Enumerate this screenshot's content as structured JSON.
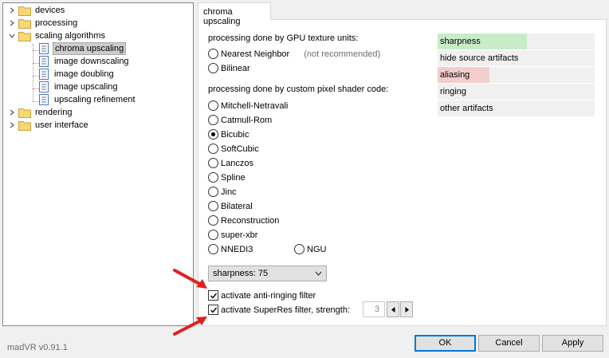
{
  "tree": {
    "items": [
      {
        "label": "devices"
      },
      {
        "label": "processing"
      },
      {
        "label": "scaling algorithms"
      },
      {
        "label": "chroma upscaling"
      },
      {
        "label": "image downscaling"
      },
      {
        "label": "image doubling"
      },
      {
        "label": "image upscaling"
      },
      {
        "label": "upscaling refinement"
      },
      {
        "label": "rendering"
      },
      {
        "label": "user interface"
      }
    ]
  },
  "tab": {
    "label": "chroma upscaling"
  },
  "gpu_section": {
    "heading": "processing done by GPU texture units:",
    "nearest": "Nearest Neighbor",
    "nearest_note": "(not recommended)",
    "bilinear": "Bilinear"
  },
  "shader_section": {
    "heading": "processing done by custom pixel shader code:",
    "options": [
      "Mitchell-Netravali",
      "Catmull-Rom",
      "Bicubic",
      "SoftCubic",
      "Lanczos",
      "Spline",
      "Jinc",
      "Bilateral",
      "Reconstruction",
      "super-xbr",
      "NNEDI3",
      "NGU"
    ],
    "selected": "Bicubic"
  },
  "sharpness_combo": {
    "value": "sharpness: 75"
  },
  "anti_ringing": {
    "label": "activate anti-ringing filter",
    "checked": true
  },
  "superres": {
    "label": "activate SuperRes filter, strength:",
    "checked": true,
    "strength": "3"
  },
  "quality_bars": [
    {
      "label": "sharpness",
      "level": 0.57,
      "color": "#c8ecc8"
    },
    {
      "label": "hide source artifacts",
      "level": 0,
      "color": "#f0f0f0"
    },
    {
      "label": "aliasing",
      "level": 0.33,
      "color": "#f2cdcd"
    },
    {
      "label": "ringing",
      "level": 0,
      "color": "#f0f0f0"
    },
    {
      "label": "other artifacts",
      "level": 0,
      "color": "#f0f0f0"
    }
  ],
  "footer": {
    "version": "madVR v0.91.1",
    "ok": "OK",
    "cancel": "Cancel",
    "apply": "Apply"
  },
  "colors": {
    "accent": "#0078d7",
    "annotation_arrow": "#e02020"
  }
}
